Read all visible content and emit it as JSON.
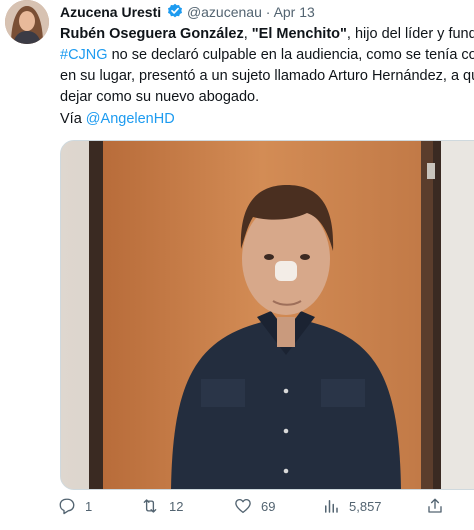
{
  "tweet": {
    "author_name": "Azucena Uresti",
    "handle": "@azucenau",
    "separator": "·",
    "date": "Apr 13",
    "text": {
      "l1_name": "Rubén Oseguera González",
      "l1_sep": ", ",
      "l1_alias": "\"El Menchito\"",
      "l1_rest": ", hijo del líder y fundador d",
      "l2_hashtag": "#CJNG",
      "l2_rest": " no se declaró culpable en la audiencia, como se tenía contemp",
      "l3": "en su lugar, presentó a un sujeto llamado Arturo Hernández, a quien d",
      "l4": "dejar como su nuevo abogado."
    },
    "via_prefix": "Vía ",
    "via_handle": "@AngelenHD"
  },
  "actions": {
    "replies": "1",
    "retweets": "12",
    "likes": "69",
    "views": "5,857"
  },
  "colors": {
    "link": "#1d9bf0",
    "secondary_text": "#536471",
    "verified": "#1d9bf0",
    "door": "#c47a45",
    "shirt": "#232d3e"
  },
  "icons": {
    "verified": "verified-badge-icon",
    "reply": "reply-icon",
    "retweet": "retweet-icon",
    "like": "heart-icon",
    "views": "views-bar-chart-icon",
    "share": "share-icon"
  }
}
